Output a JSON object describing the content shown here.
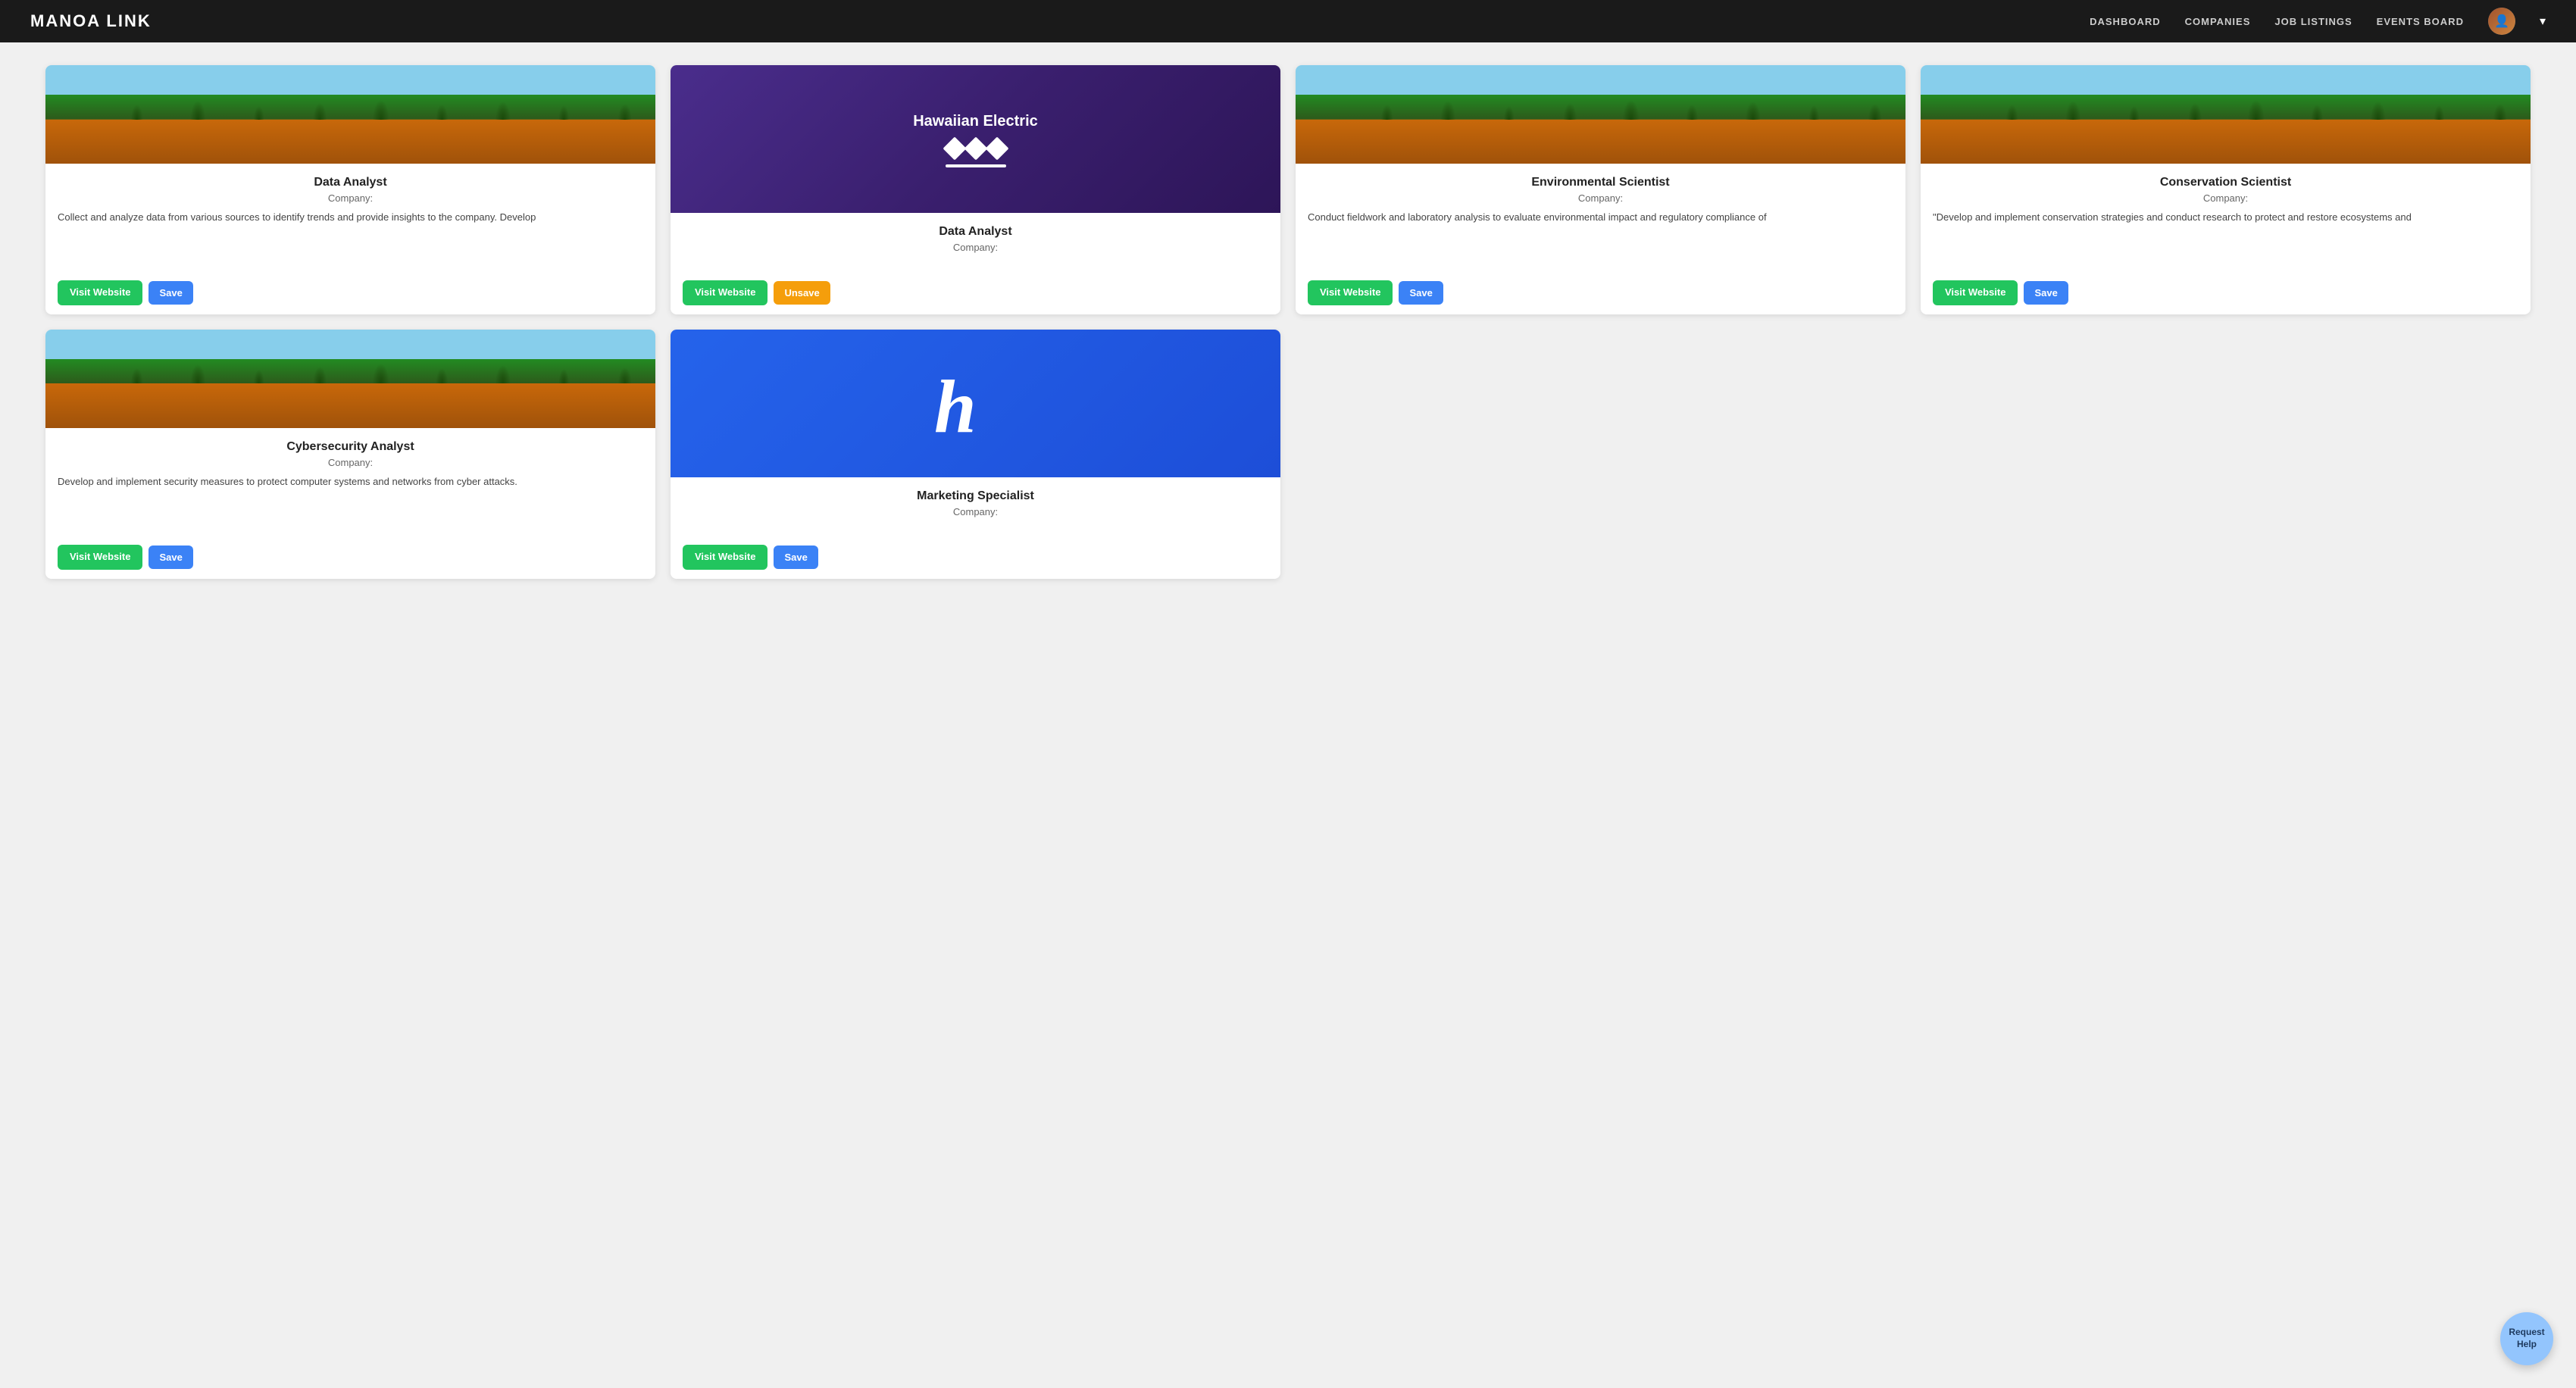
{
  "navbar": {
    "brand": "MANOA LINK",
    "links": [
      {
        "label": "DASHBOARD",
        "id": "dashboard"
      },
      {
        "label": "COMPANIES",
        "id": "companies"
      },
      {
        "label": "JOB LISTINGS",
        "id": "job-listings"
      },
      {
        "label": "EVENTS BOARD",
        "id": "events-board"
      }
    ],
    "avatar_label": "User Avatar",
    "dropdown_arrow": "▾"
  },
  "cards_row1": [
    {
      "id": "data-analyst-1",
      "title": "Data Analyst",
      "company_label": "Company:",
      "description": "Collect and analyze data from various sources to identify trends and provide insights to the company. Develop",
      "has_save": true,
      "has_unsave": false,
      "save_label": "Save",
      "visit_label": "Visit Website",
      "image_type": "nature"
    },
    {
      "id": "data-analyst-hawaiian",
      "title": "Data Analyst",
      "company_label": "Company:",
      "description": "",
      "has_save": false,
      "has_unsave": true,
      "save_label": "Save",
      "unsave_label": "Unsave",
      "visit_label": "Visit Website",
      "image_type": "hawaiian",
      "hawaiian_title": "Hawaiian Electric"
    },
    {
      "id": "environmental-scientist",
      "title": "Environmental Scientist",
      "company_label": "Company:",
      "description": "Conduct fieldwork and laboratory analysis to evaluate environmental impact and regulatory compliance of",
      "has_save": true,
      "has_unsave": false,
      "save_label": "Save",
      "visit_label": "Visit Website",
      "image_type": "nature"
    },
    {
      "id": "conservation-scientist",
      "title": "Conservation Scientist",
      "company_label": "Company:",
      "description": "\"Develop and implement conservation strategies and conduct research to protect and restore ecosystems and",
      "has_save": true,
      "has_unsave": false,
      "save_label": "Save",
      "visit_label": "Visit Website",
      "image_type": "nature"
    }
  ],
  "cards_row2": [
    {
      "id": "cybersecurity-analyst",
      "title": "Cybersecurity Analyst",
      "company_label": "Company:",
      "description": "Develop and implement security measures to protect computer systems and networks from cyber attacks.",
      "has_save": true,
      "has_unsave": false,
      "save_label": "Save",
      "visit_label": "Visit Website",
      "image_type": "nature"
    },
    {
      "id": "marketing-specialist",
      "title": "Marketing Specialist",
      "company_label": "Company:",
      "description": "",
      "has_save": true,
      "has_unsave": false,
      "save_label": "Save",
      "visit_label": "Visit Website",
      "image_type": "blue-logo"
    }
  ],
  "request_help": {
    "label": "Request Help"
  }
}
